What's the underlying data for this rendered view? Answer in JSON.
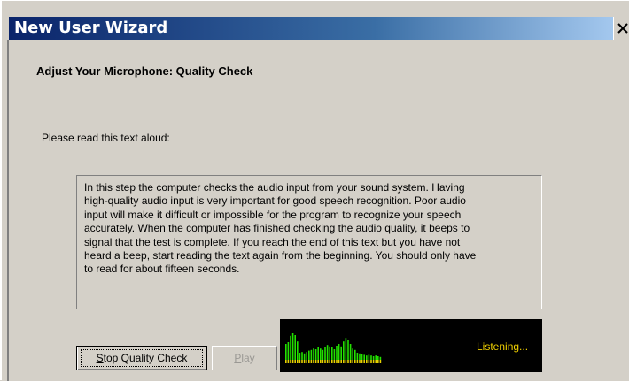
{
  "window": {
    "title": "New User Wizard",
    "close_glyph": "X"
  },
  "page": {
    "heading": "Adjust Your Microphone: Quality Check",
    "prompt": "Please read this text aloud:",
    "read_text": "In this step the computer checks the audio input from your sound system. Having\nhigh-quality audio input is very important for good speech recognition. Poor audio\ninput will make it difficult or impossible for the program to recognize your speech\naccurately. When the computer has finished checking the audio quality, it beeps to\nsignal that the test is complete. If you reach the end of this text but you have not\nheard a beep, start reading the text again from the beginning. You should only have\nto read for about fifteen seconds."
  },
  "buttons": {
    "stop": {
      "label_prefix": "",
      "underlined": "S",
      "label_rest": "top Quality Check",
      "enabled": true
    },
    "play": {
      "label_prefix": "",
      "underlined": "P",
      "label_rest": "lay",
      "enabled": false
    }
  },
  "meter": {
    "status": "Listening...",
    "status_color": "#f0d000",
    "bar_color_green": "#22e000",
    "bar_color_yellow": "#e6d200",
    "levels": [
      0.55,
      0.6,
      0.78,
      0.85,
      0.8,
      0.62,
      0.3,
      0.32,
      0.28,
      0.32,
      0.36,
      0.38,
      0.42,
      0.4,
      0.45,
      0.42,
      0.38,
      0.46,
      0.52,
      0.48,
      0.45,
      0.4,
      0.5,
      0.55,
      0.48,
      0.62,
      0.72,
      0.65,
      0.55,
      0.42,
      0.38,
      0.3,
      0.28,
      0.26,
      0.24,
      0.22,
      0.24,
      0.22,
      0.2,
      0.22,
      0.2,
      0.18
    ]
  }
}
